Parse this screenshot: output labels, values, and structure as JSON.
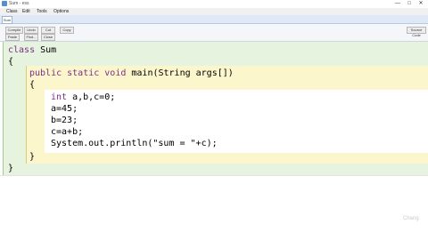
{
  "window": {
    "title": "Sum - ess",
    "minimize": "—",
    "maximize": "□",
    "close": "✕"
  },
  "menu": [
    "Class",
    "Edit",
    "Tools",
    "Options"
  ],
  "tab": {
    "label": "Sum"
  },
  "toolbar": {
    "row1": [
      "Compile",
      "Undo",
      "Cut",
      "Copy"
    ],
    "row2": [
      "Paste",
      "Find...",
      "Close"
    ],
    "right": "Source Code"
  },
  "code": {
    "line1_kw": "class",
    "line1_rest": " Sum",
    "line2": "{",
    "line3_kw": "public static void",
    "line3_rest": " main(String args[])",
    "line4": "{",
    "line5_kw": "int",
    "line5_rest": " a,b,c=0;",
    "line6": "a=45;",
    "line7": "b=23;",
    "line8": "c=a+b;",
    "line9": "System.out.println(\"sum = \"+c);",
    "line10": "}",
    "line11": "}"
  },
  "colors": {
    "class_band": "#e6f3df",
    "method_band": "#fbf6cc",
    "body_band": "#ffffff",
    "keyword": "#7a2f86"
  },
  "watermark": "Chang"
}
